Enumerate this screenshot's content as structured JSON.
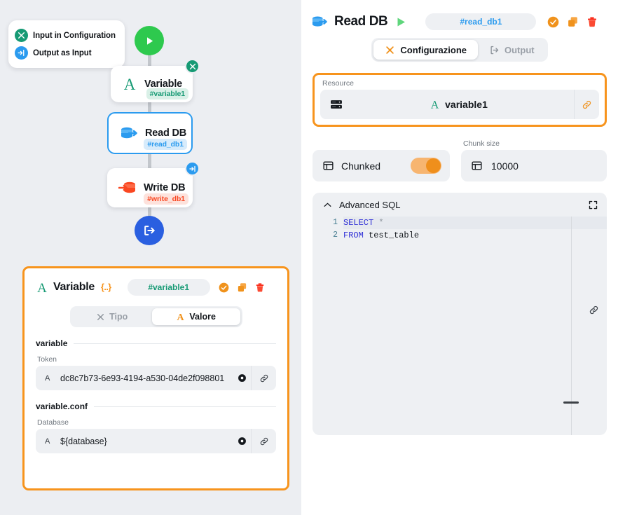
{
  "canvas": {
    "legend": {
      "items": [
        {
          "icon": "tools-icon",
          "label": "Input in Configuration",
          "color": "#169a74"
        },
        {
          "icon": "arrow-into-bracket-icon",
          "label": "Output as Input",
          "color": "#2b9bef"
        }
      ]
    },
    "start_node": {
      "icon": "play-icon",
      "color": "#2ec94e"
    },
    "end_node": {
      "icon": "exit-icon",
      "color": "#2a5fe0"
    },
    "nodes": [
      {
        "icon": "variable-icon",
        "title": "Variable",
        "tag": "#variable1",
        "badge": "tools-icon",
        "selected": false
      },
      {
        "icon": "read-db-icon",
        "title": "Read DB",
        "tag": "#read_db1",
        "badge": "",
        "selected": true
      },
      {
        "icon": "write-db-icon",
        "title": "Write DB",
        "tag": "#write_db1",
        "badge": "arrow-into-bracket-icon",
        "selected": false
      }
    ]
  },
  "variable_panel": {
    "icon": "variable-icon",
    "title": "Variable",
    "braces": "{..}",
    "id": "#variable1",
    "actions": [
      {
        "name": "confirm-icon",
        "label": ""
      },
      {
        "name": "duplicate-icon",
        "label": ""
      },
      {
        "name": "delete-icon",
        "label": ""
      }
    ],
    "tabs": [
      {
        "icon": "tools-icon",
        "label": "Tipo",
        "active": false
      },
      {
        "icon": "variable-icon",
        "label": "Valore",
        "active": true
      }
    ],
    "sections": [
      {
        "title": "variable",
        "fields": [
          {
            "label": "Token",
            "kind": "A",
            "value": "dc8c7b73-6e93-4194-a530-04de2f098801"
          }
        ]
      },
      {
        "title": "variable.conf",
        "fields": [
          {
            "label": "Database",
            "kind": "A",
            "value": "${database}"
          }
        ]
      }
    ]
  },
  "right_panel": {
    "icon": "read-db-icon",
    "title": "Read DB",
    "run_icon": "play-icon",
    "id": "#read_db1",
    "actions": [
      {
        "name": "confirm-icon"
      },
      {
        "name": "duplicate-icon"
      },
      {
        "name": "delete-icon"
      }
    ],
    "tabs": [
      {
        "icon": "tools-icon",
        "label": "Configurazione",
        "active": true
      },
      {
        "icon": "output-icon",
        "label": "Output",
        "active": false
      }
    ],
    "resource": {
      "label": "Resource",
      "icon": "server-icon",
      "kind": "A",
      "value": "variable1",
      "link_icon": "link-icon"
    },
    "chunked": {
      "icon": "table-icon",
      "label": "Chunked",
      "enabled": true
    },
    "chunk_size": {
      "label": "Chunk size",
      "icon": "table-icon",
      "value": "10000"
    },
    "sql": {
      "collapse_icon": "chevron-up-icon",
      "title": "Advanced SQL",
      "expand_icon": "fullscreen-icon",
      "link_icon": "link-icon",
      "lines": [
        {
          "no": "1",
          "keyword": "SELECT",
          "rest": " ",
          "symbol": "*",
          "tail": ""
        },
        {
          "no": "2",
          "keyword": "FROM",
          "rest": " test_table",
          "symbol": "",
          "tail": ""
        }
      ]
    }
  },
  "colors": {
    "accent_orange": "#f7941d",
    "teal": "#169a74",
    "blue": "#2b9bef",
    "red": "#fa4721",
    "green": "#2ec94e",
    "deep_blue": "#2a5fe0"
  }
}
